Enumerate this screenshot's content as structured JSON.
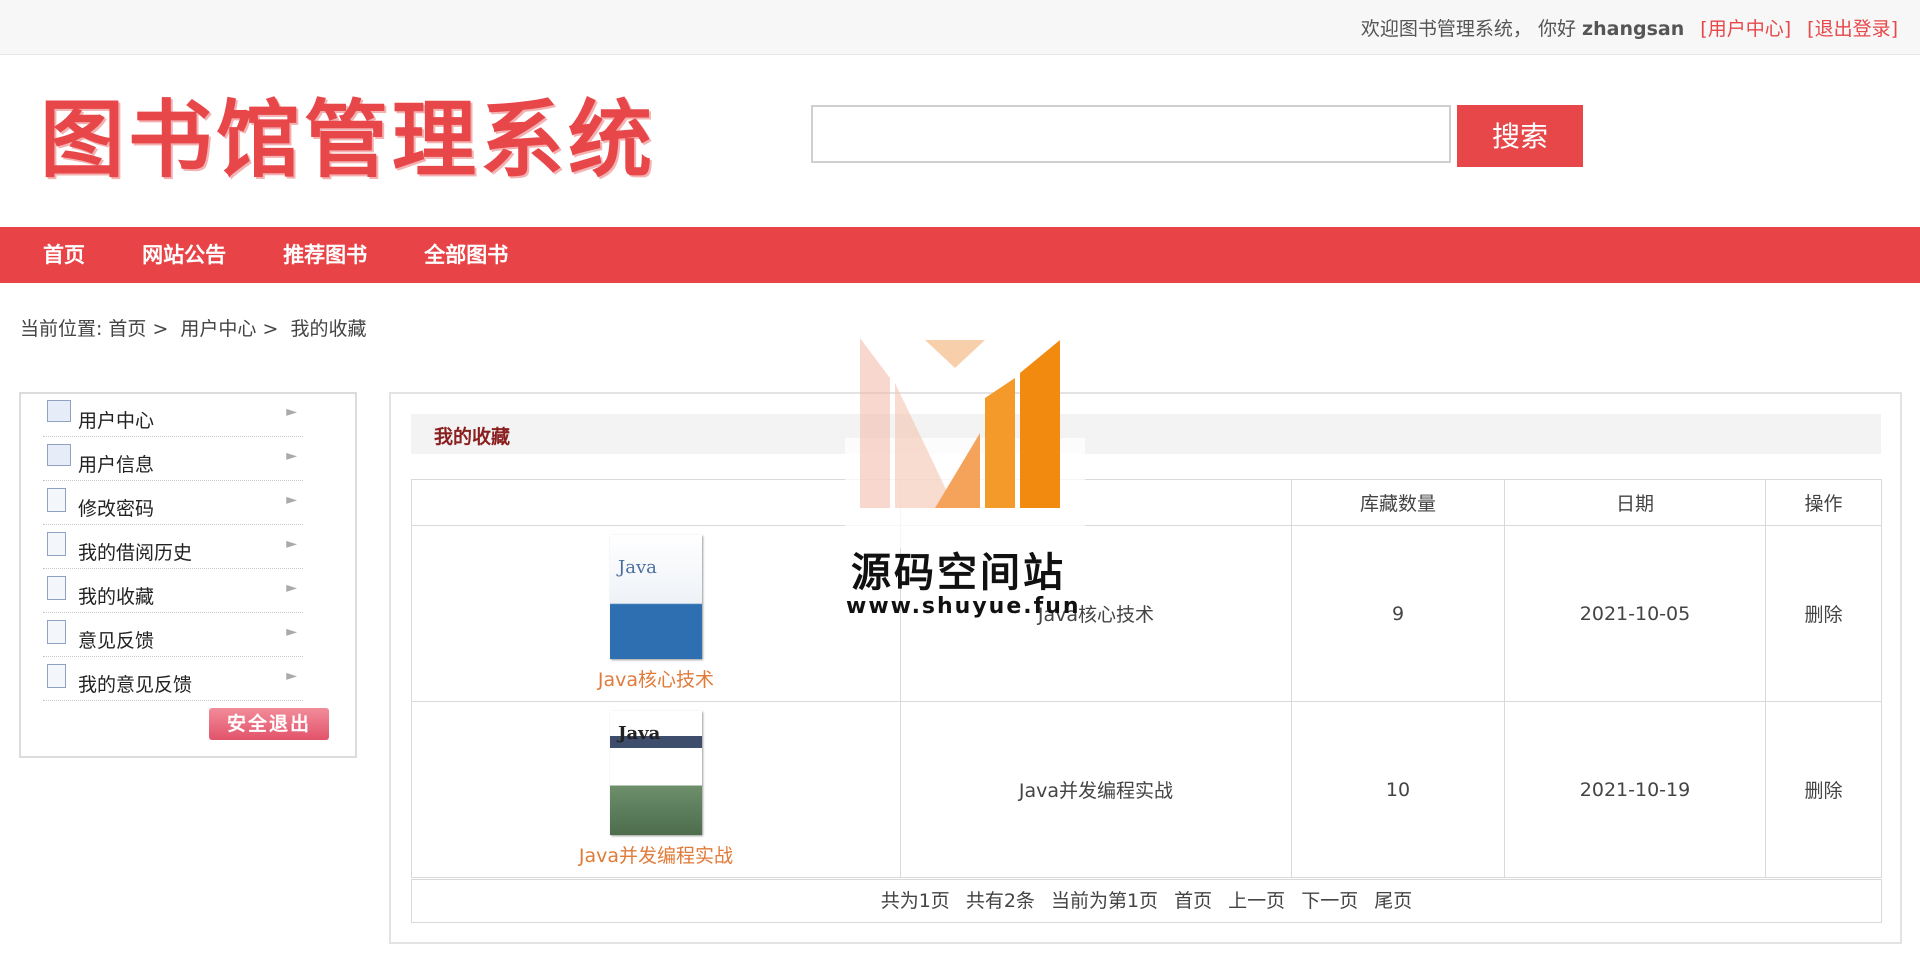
{
  "topbar": {
    "welcome": "欢迎图书管理系统，",
    "greeting": "你好",
    "username": "zhangsan",
    "user_center_link": "[用户中心]",
    "logout_link": "[退出登录]"
  },
  "logo": {
    "text": "图书馆管理系统"
  },
  "search": {
    "placeholder": "",
    "button_label": "搜索"
  },
  "nav": {
    "items": [
      "首页",
      "网站公告",
      "推荐图书",
      "全部图书"
    ]
  },
  "breadcrumb": {
    "prefix": "当前位置:",
    "items": [
      "首页 >",
      "用户中心 >",
      "我的收藏"
    ]
  },
  "sidebar": {
    "items": [
      {
        "label": "用户中心",
        "icon": "id-card-icon"
      },
      {
        "label": "用户信息",
        "icon": "id-card-icon"
      },
      {
        "label": "修改密码",
        "icon": "document-icon"
      },
      {
        "label": "我的借阅历史",
        "icon": "document-icon"
      },
      {
        "label": "我的收藏",
        "icon": "document-icon"
      },
      {
        "label": "意见反馈",
        "icon": "document-icon"
      },
      {
        "label": "我的意见反馈",
        "icon": "document-icon"
      }
    ],
    "logout_button": "安全退出"
  },
  "panel": {
    "title": "我的收藏",
    "columns": [
      "",
      "",
      "库藏数量",
      "日期",
      "操作"
    ],
    "rows": [
      {
        "cover_text": "Java",
        "cover_name": "Java核心技术",
        "name": "Java核心技术",
        "stock": "9",
        "date": "2021-10-05",
        "action": "删除"
      },
      {
        "cover_text": "Java",
        "cover_name": "Java并发编程实战",
        "name": "Java并发编程实战",
        "stock": "10",
        "date": "2021-10-19",
        "action": "删除"
      }
    ],
    "pager": [
      "共为1页",
      "共有2条",
      "当前为第1页",
      "首页",
      "上一页",
      "下一页",
      "尾页"
    ]
  },
  "watermark": {
    "title": "源码空间站",
    "url": "www.shuyue.fun"
  },
  "colors": {
    "accent": "#e8474a",
    "nav": "#e84448",
    "book_link": "#e07b39",
    "watermark_orange": "#f39a2b"
  }
}
